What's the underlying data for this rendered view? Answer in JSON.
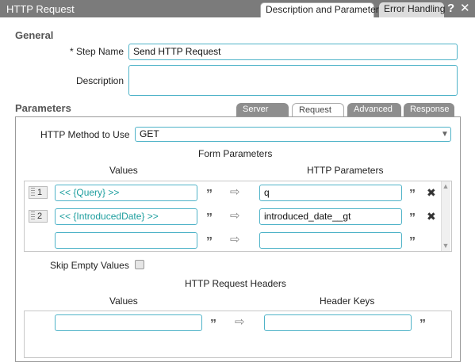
{
  "titlebar": {
    "title": "HTTP Request",
    "tabs": [
      {
        "label": "Description and Parameters"
      },
      {
        "label": "Error Handling"
      }
    ],
    "help_icon": "?",
    "close_icon": "✕"
  },
  "general": {
    "title": "General",
    "step_name_label": "* Step Name",
    "step_name_value": "Send HTTP Request",
    "description_label": "Description",
    "description_value": ""
  },
  "parameters": {
    "title": "Parameters",
    "tabs": [
      {
        "label": "Server"
      },
      {
        "label": "Request"
      },
      {
        "label": "Advanced"
      },
      {
        "label": "Response"
      }
    ],
    "method_label": "HTTP Method to Use",
    "method_value": "GET",
    "form_title": "Form Parameters",
    "values_header": "Values",
    "http_params_header": "HTTP Parameters",
    "rows": [
      {
        "num": "1",
        "value": "<< {Query} >>",
        "param": "q"
      },
      {
        "num": "2",
        "value": "<< {IntroducedDate} >>",
        "param": "introduced_date__gt"
      },
      {
        "num": "",
        "value": "",
        "param": ""
      }
    ],
    "quote_glyph": "”",
    "arrow_glyph": "⇨",
    "skip_empty_label": "Skip Empty Values",
    "headers_title": "HTTP Request Headers",
    "headers_values_header": "Values",
    "header_keys_header": "Header Keys"
  },
  "colors": {
    "titlebar": "#7b7b7b",
    "field_border": "#4fb3c8",
    "variable_text": "#1d9e9e",
    "subtab_inactive": "#8e8e8e"
  }
}
